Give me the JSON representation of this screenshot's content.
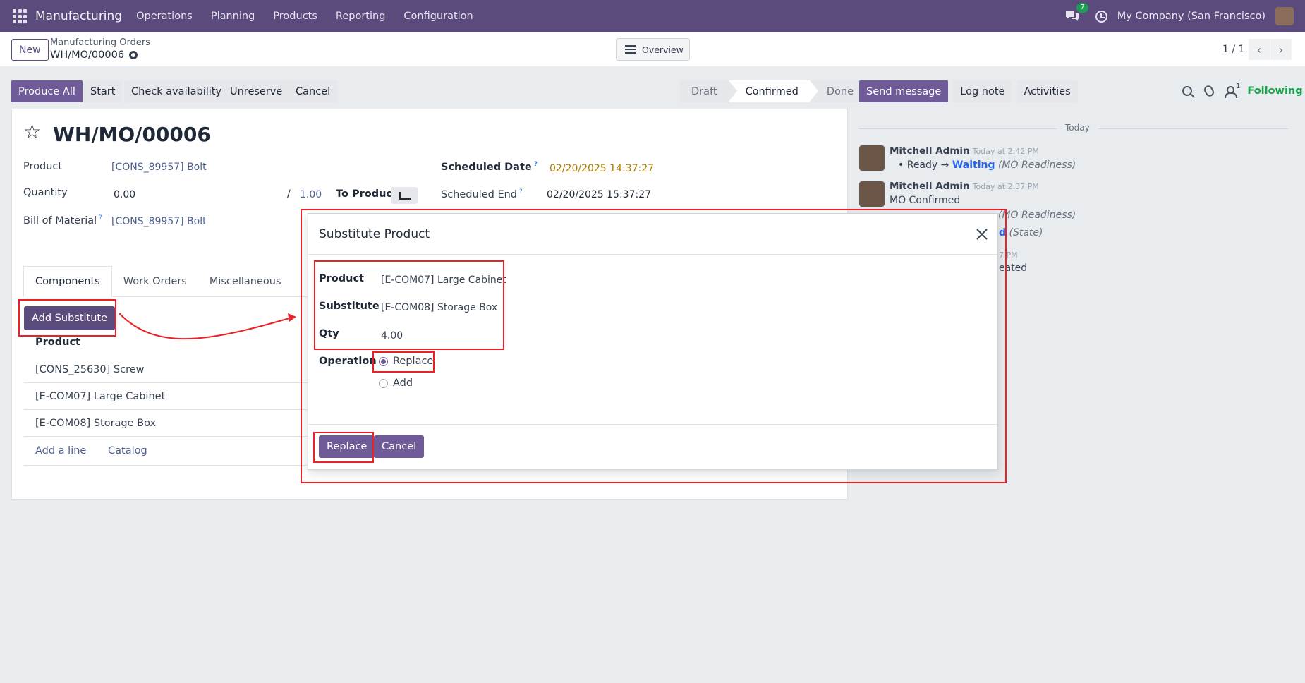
{
  "navbar": {
    "app_name": "Manufacturing",
    "menu": [
      "Operations",
      "Planning",
      "Products",
      "Reporting",
      "Configuration"
    ],
    "chat_badge": "7",
    "company": "My Company (San Francisco)"
  },
  "control": {
    "new_label": "New",
    "breadcrumb_parent": "Manufacturing Orders",
    "breadcrumb_current": "WH/MO/00006",
    "overview_label": "Overview",
    "pager": "1 / 1"
  },
  "actions": {
    "produce_all": "Produce All",
    "start": "Start",
    "check_availability": "Check availability",
    "unreserve": "Unreserve",
    "cancel": "Cancel",
    "status_steps": [
      "Draft",
      "Confirmed",
      "Done"
    ],
    "status_active": "Confirmed",
    "send_message": "Send message",
    "log_note": "Log note",
    "activities": "Activities",
    "follower_count": "1",
    "following": "Following"
  },
  "form": {
    "title": "WH/MO/00006",
    "product_label": "Product",
    "product_value": "[CONS_89957] Bolt",
    "quantity_label": "Quantity",
    "quantity_value": "0.00",
    "quantity_sep": "/",
    "quantity_total": "1.00",
    "to_produce": "To Produce",
    "bom_label": "Bill of Material",
    "bom_value": "[CONS_89957] Bolt",
    "scheduled_date_label": "Scheduled Date",
    "scheduled_date_value": "02/20/2025 14:37:27",
    "scheduled_end_label": "Scheduled End",
    "scheduled_end_value": "02/20/2025 15:37:27",
    "help_mark": "?",
    "tabs": [
      "Components",
      "Work Orders",
      "Miscellaneous"
    ],
    "add_substitute": "Add Substitute",
    "table_header": "Product",
    "rows": [
      "[CONS_25630] Screw",
      "[E-COM07] Large Cabinet",
      "[E-COM08] Storage Box"
    ],
    "add_line": "Add a line",
    "catalog": "Catalog"
  },
  "chatter": {
    "today": "Today",
    "messages": [
      {
        "author": "Mitchell Admin",
        "time": "Today at 2:42 PM",
        "from": "Ready",
        "arrow": "→",
        "to": "Waiting",
        "field": "(MO Readiness)"
      },
      {
        "author": "Mitchell Admin",
        "time": "Today at 2:37 PM",
        "text": "MO Confirmed",
        "partial1": "(MO Readiness)",
        "partial2_a": "d",
        "partial2_b": "(State)",
        "partial3": "eated",
        "partial_time": "7 PM"
      }
    ]
  },
  "modal": {
    "title": "Substitute Product",
    "product_label": "Product",
    "product_value": "[E-COM07] Large Cabinet",
    "substitute_label": "Substitute",
    "substitute_value": "[E-COM08] Storage Box",
    "qty_label": "Qty",
    "qty_value": "4.00",
    "operation_label": "Operation",
    "options": [
      "Replace",
      "Add"
    ],
    "selected": "Replace",
    "replace_btn": "Replace",
    "cancel_btn": "Cancel"
  },
  "colors": {
    "brand": "#5b4b7c",
    "primary_button": "#6e5b98",
    "annotation": "#ea2127",
    "following": "#16a34a"
  }
}
